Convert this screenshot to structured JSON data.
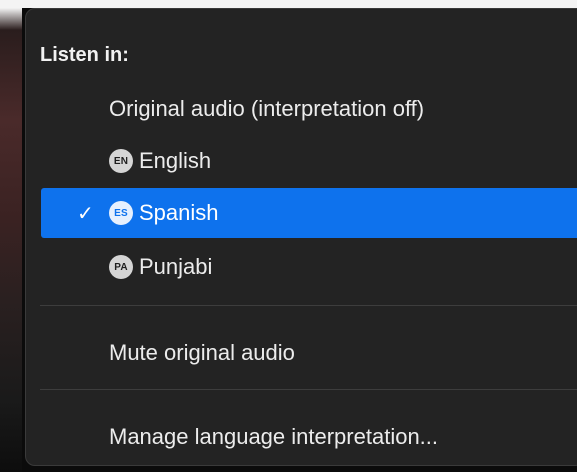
{
  "menu": {
    "header": "Listen in:",
    "options": [
      {
        "label": "Original audio (interpretation off)",
        "badge": null,
        "selected": false
      },
      {
        "label": "English",
        "badge": "EN",
        "selected": false
      },
      {
        "label": "Spanish",
        "badge": "ES",
        "selected": true
      },
      {
        "label": "Punjabi",
        "badge": "PA",
        "selected": false
      }
    ],
    "check_glyph": "✓",
    "mute_label": "Mute original audio",
    "manage_label": "Manage language interpretation..."
  },
  "colors": {
    "menu_bg": "#232323",
    "selected_bg": "#0e72ed",
    "text": "#ececec"
  },
  "icons": [
    "checkmark-icon",
    "language-badge-icon"
  ]
}
